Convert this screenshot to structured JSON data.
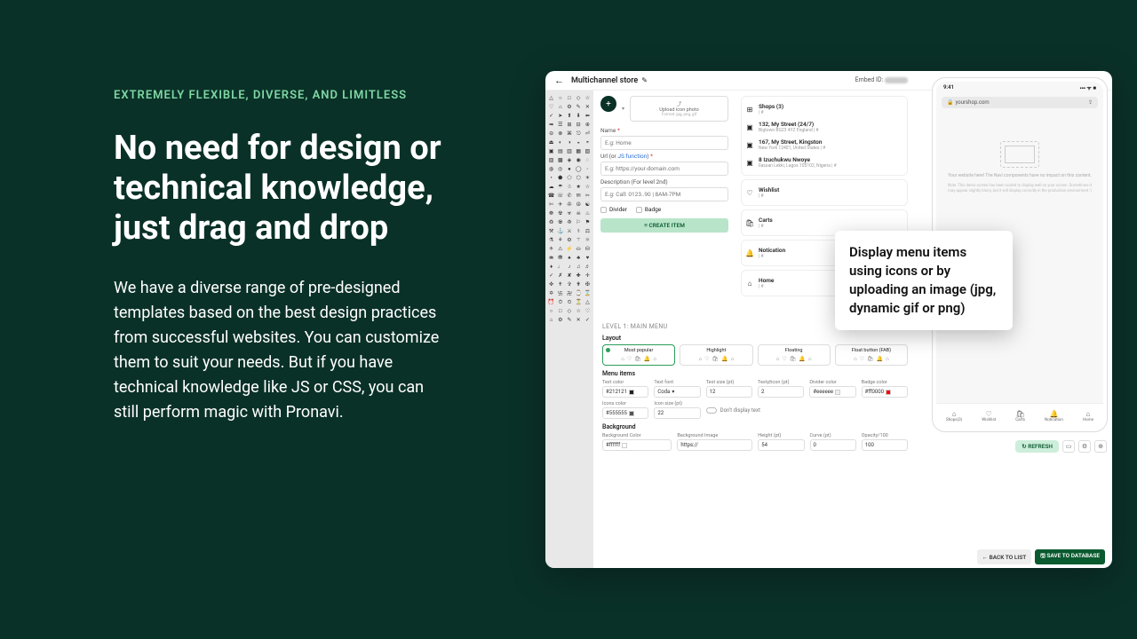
{
  "hero": {
    "eyebrow": "EXTREMELY FLEXIBLE, DIVERSE, AND LIMITLESS",
    "headline": "No need for design or technical knowledge, just drag and drop",
    "body": "We have a diverse range of pre-designed templates based on the best design practices from successful websites. You can customize them to suit your needs. But if you have technical knowledge like JS or CSS, you can still perform magic with Pronavi."
  },
  "callout": "Display menu items using icons or by uploading an image (jpg, dynamic gif or png)",
  "app": {
    "title": "Multichannel store",
    "embed_label": "Embed ID:",
    "upload": {
      "title": "Upload icon photo",
      "sub": "Format: jpg, png, gif"
    },
    "form": {
      "name_label": "Name",
      "name_ph": "E.g: Home",
      "url_label_a": "Url (or ",
      "url_label_b": "JS function",
      "url_label_c": ")",
      "url_ph": "E.g: https://your-domain.com",
      "desc_label": "Description (For level 2nd)",
      "desc_ph": "E.g: Call: 0123..90 | 8AM-7PM",
      "divider": "Divider",
      "badge": "Badge",
      "create": "≡ CREATE ITEM"
    },
    "shops": {
      "header": "Shops (3)",
      "sub": "| #",
      "list": [
        {
          "name": "132, My Street (24/7)",
          "sub": "Bigtown BG23 4YZ England | #"
        },
        {
          "name": "167, My Street, Kingston",
          "sub": "New York 12401, United States | #"
        },
        {
          "name": "8 Izuchukwu Nwoye",
          "sub": "Ilassan Lekki, Lagos 105102, Nigeria | #"
        }
      ]
    },
    "nav_items": [
      {
        "icon": "♡",
        "label": "Wishlist",
        "sub": "| #"
      },
      {
        "icon": "🛍",
        "label": "Carts",
        "sub": "| #"
      },
      {
        "icon": "🔔",
        "label": "Notication",
        "sub": "| #"
      },
      {
        "icon": "⌂",
        "label": "Home",
        "sub": "| #"
      }
    ],
    "level_label": "LEVEL 1: MAIN MENU",
    "layout_label": "Layout",
    "layouts": [
      "Most popular",
      "Highlight",
      "Floating",
      "Float button (FAB)"
    ],
    "menu_items_label": "Menu items",
    "fields": {
      "text_color": {
        "lb": "Text color",
        "val": "#212121"
      },
      "text_font": {
        "lb": "Text font",
        "val": "Coda"
      },
      "text_size": {
        "lb": "Text size (pt)",
        "val": "12"
      },
      "text_icon": {
        "lb": "Text⇄icon (pt)",
        "val": "2"
      },
      "divider_color": {
        "lb": "Divider color",
        "val": "#eeeeee"
      },
      "badge_color": {
        "lb": "Badge color",
        "val": "#ff0000"
      },
      "icons_color": {
        "lb": "Icons color",
        "val": "#555555"
      },
      "icon_size": {
        "lb": "Icon size (pt)",
        "val": "22"
      },
      "dont_display": "Don't display text"
    },
    "bg_label": "Background",
    "bg": {
      "color": {
        "lb": "Background Color",
        "val": "#ffffff"
      },
      "image": {
        "lb": "Background Image",
        "val": "https://"
      },
      "height": {
        "lb": "Height (pt)",
        "val": "54"
      },
      "curve": {
        "lb": "Curve (pt)",
        "val": "0"
      },
      "opacity": {
        "lb": "Opacity/100",
        "val": "100"
      }
    },
    "footer": {
      "back": "← BACK TO LIST",
      "save": "🖫 SAVE TO DATABASE"
    }
  },
  "phone": {
    "time": "9:41",
    "signals": "▪▪▪ ᯤ ■",
    "url": "yourshop.com",
    "msg": "Your website here! The Navi components have no impact on this content.",
    "note": "Note: This demo screen has been scaled to display well on your screen. Sometimes it may appear slightly blurry, but it will display correctly in the production environment :)",
    "tabs": [
      {
        "ic": "⌂",
        "lb": "Shops(3)"
      },
      {
        "ic": "♡",
        "lb": "Wishlist"
      },
      {
        "ic": "🛍",
        "lb": "Carts"
      },
      {
        "ic": "🔔",
        "lb": "Notication"
      },
      {
        "ic": "⌂",
        "lb": "Home"
      }
    ],
    "refresh": "↻ REFRESH"
  }
}
